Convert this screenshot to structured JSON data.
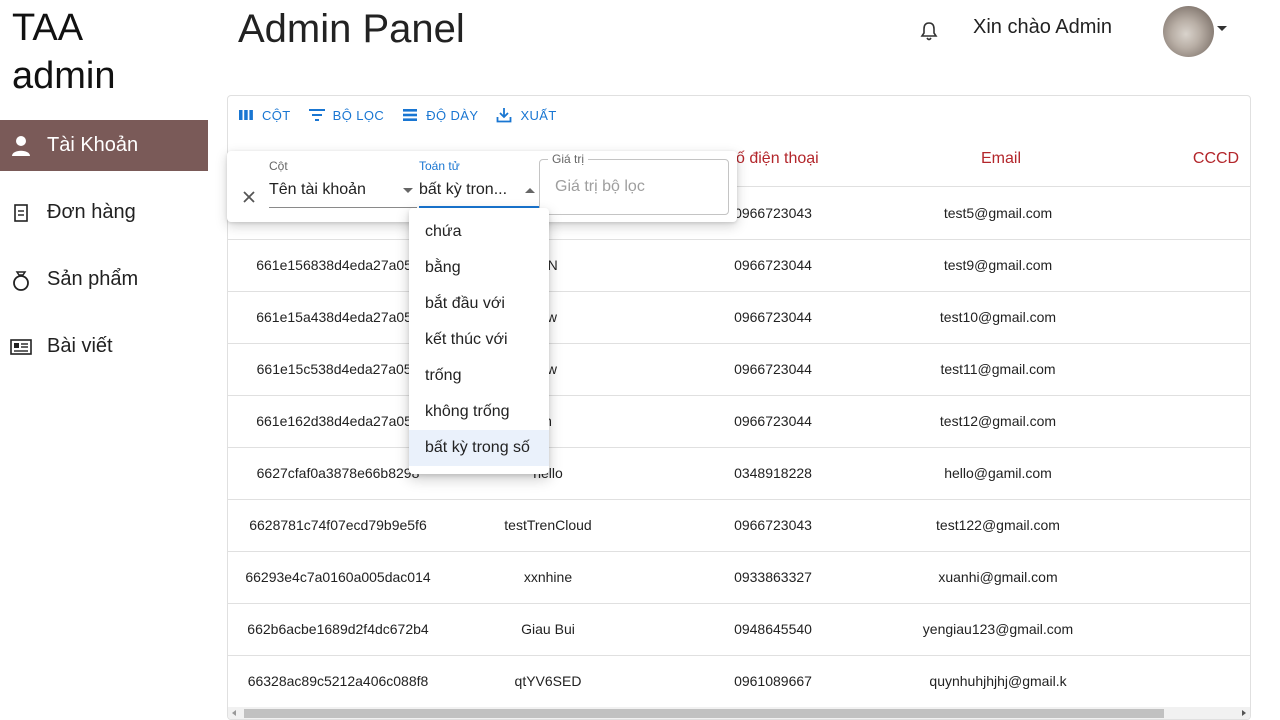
{
  "sidebar": {
    "brand_line1": "TAA",
    "brand_line2": "admin",
    "items": [
      {
        "label": "Tài Khoản",
        "icon": "person-icon",
        "active": true
      },
      {
        "label": "Đơn hàng",
        "icon": "document-icon",
        "active": false
      },
      {
        "label": "Sản phẩm",
        "icon": "ring-icon",
        "active": false
      },
      {
        "label": "Bài viết",
        "icon": "newspaper-icon",
        "active": false
      }
    ]
  },
  "header": {
    "title": "Admin Panel",
    "greeting": "Xin chào Admin",
    "icons": [
      "bell-icon",
      "avatar",
      "caret-down-icon"
    ]
  },
  "toolbar": {
    "columns_label": "CỘT",
    "filters_label": "BỘ LỌC",
    "density_label": "ĐỘ DÀY",
    "export_label": "XUẤT"
  },
  "table": {
    "headers": {
      "phone": "ố điện thoại",
      "email": "Email",
      "cccd": "CCCD"
    },
    "rows": [
      {
        "id": "",
        "name": "",
        "phone": "0966723043",
        "email": "test5@gmail.com"
      },
      {
        "id": "661e156838d4eda27a05b",
        "name": "AN",
        "phone": "0966723044",
        "email": "test9@gmail.com"
      },
      {
        "id": "661e15a438d4eda27a05b",
        "name": "ew",
        "phone": "0966723044",
        "email": "test10@gmail.com"
      },
      {
        "id": "661e15c538d4eda27a05b",
        "name": "ew",
        "phone": "0966723044",
        "email": "test11@gmail.com"
      },
      {
        "id": "661e162d38d4eda27a05b",
        "name": "n",
        "phone": "0966723044",
        "email": "test12@gmail.com"
      },
      {
        "id": "6627cfaf0a3878e66b8298",
        "name": "hello",
        "phone": "0348918228",
        "email": "hello@gamil.com"
      },
      {
        "id": "6628781c74f07ecd79b9e5f6",
        "name": "testTrenCloud",
        "phone": "0966723043",
        "email": "test122@gmail.com"
      },
      {
        "id": "66293e4c7a0160a005dac014",
        "name": "xxnhine",
        "phone": "0933863327",
        "email": "xuanhi@gmail.com"
      },
      {
        "id": "662b6acbe1689d2f4dc672b4",
        "name": "Giau Bui",
        "phone": "0948645540",
        "email": "yengiau123@gmail.com"
      },
      {
        "id": "66328ac89c5212a406c088f8",
        "name": "qtYV6SED",
        "phone": "0961089667",
        "email": "quynhuhjhjhj@gmail.k"
      }
    ]
  },
  "filter": {
    "column_label": "Cột",
    "column_value": "Tên tài khoản",
    "operator_label": "Toán tử",
    "operator_value": "bất kỳ tron...",
    "value_label": "Giá trị",
    "value_placeholder": "Giá trị bộ lọc",
    "operators": [
      "chứa",
      "bằng",
      "bắt đầu với",
      "kết thúc với",
      "trống",
      "không trống",
      "bất kỳ trong số"
    ],
    "selected_operator": "bất kỳ trong số"
  },
  "colors": {
    "sidebar_active": "#7a5a58",
    "header_text": "#b3262b",
    "toolbar_accent": "#1976d2"
  }
}
